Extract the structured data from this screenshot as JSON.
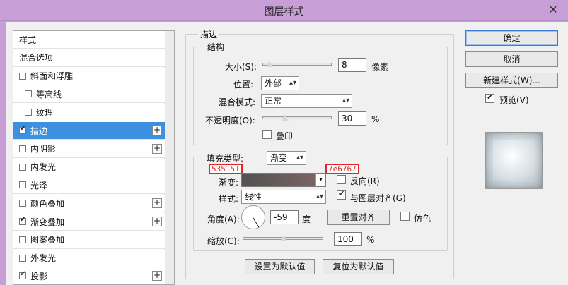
{
  "window": {
    "title": "图层样式"
  },
  "sidebar": {
    "items": [
      {
        "label": "样式",
        "checkbox": false,
        "checked": false,
        "plus": false,
        "indent": false,
        "selected": false
      },
      {
        "label": "混合选项",
        "checkbox": false,
        "checked": false,
        "plus": false,
        "indent": false,
        "selected": false
      },
      {
        "label": "斜面和浮雕",
        "checkbox": true,
        "checked": false,
        "plus": false,
        "indent": false,
        "selected": false
      },
      {
        "label": "等高线",
        "checkbox": true,
        "checked": false,
        "plus": false,
        "indent": true,
        "selected": false
      },
      {
        "label": "纹理",
        "checkbox": true,
        "checked": false,
        "plus": false,
        "indent": true,
        "selected": false
      },
      {
        "label": "描边",
        "checkbox": true,
        "checked": true,
        "plus": true,
        "indent": false,
        "selected": true
      },
      {
        "label": "内阴影",
        "checkbox": true,
        "checked": false,
        "plus": true,
        "indent": false,
        "selected": false
      },
      {
        "label": "内发光",
        "checkbox": true,
        "checked": false,
        "plus": false,
        "indent": false,
        "selected": false
      },
      {
        "label": "光泽",
        "checkbox": true,
        "checked": false,
        "plus": false,
        "indent": false,
        "selected": false
      },
      {
        "label": "颜色叠加",
        "checkbox": true,
        "checked": false,
        "plus": true,
        "indent": false,
        "selected": false
      },
      {
        "label": "渐变叠加",
        "checkbox": true,
        "checked": true,
        "plus": true,
        "indent": false,
        "selected": false
      },
      {
        "label": "图案叠加",
        "checkbox": true,
        "checked": false,
        "plus": false,
        "indent": false,
        "selected": false
      },
      {
        "label": "外发光",
        "checkbox": true,
        "checked": false,
        "plus": false,
        "indent": false,
        "selected": false
      },
      {
        "label": "投影",
        "checkbox": true,
        "checked": true,
        "plus": true,
        "indent": false,
        "selected": false
      }
    ],
    "plus_symbol": "+"
  },
  "stroke": {
    "section_title": "描边",
    "structure": {
      "title": "结构",
      "size_label": "大小(S):",
      "size_value": "8",
      "size_unit": "像素",
      "size_slider_level": 0.05,
      "position_label": "位置:",
      "position_value": "外部",
      "blend_label": "混合模式:",
      "blend_value": "正常",
      "opacity_label": "不透明度(O):",
      "opacity_value": "30",
      "opacity_unit": "%",
      "opacity_slider_level": 0.3,
      "overprint_label": "叠印"
    },
    "fill": {
      "fill_type_label": "填充类型:",
      "fill_type_value": "渐变",
      "gradient_label": "渐变:",
      "color_start": "535151",
      "color_end": "7e6767",
      "reverse_label": "反向(R)",
      "style_label": "样式:",
      "style_value": "线性",
      "align_label": "与图层对齐(G)",
      "angle_label": "角度(A):",
      "angle_value": "-59",
      "angle_unit": "度",
      "reset_align_label": "重置对齐",
      "dither_label": "仿色",
      "scale_label": "缩放(C):",
      "scale_value": "100",
      "scale_unit": "%",
      "scale_slider_level": 0.5
    },
    "set_default_label": "设置为默认值",
    "reset_default_label": "复位为默认值"
  },
  "actions": {
    "ok_label": "确定",
    "cancel_label": "取消",
    "new_style_label": "新建样式(W)...",
    "preview_label": "预览(V)"
  },
  "icons": {
    "close": "close-icon",
    "dropdown": "chevron-down-icon",
    "check": "check-icon"
  },
  "colors": {
    "title_bar": "#c79fd6",
    "selection": "#3d8fe0",
    "highlight": "#e0262a"
  }
}
